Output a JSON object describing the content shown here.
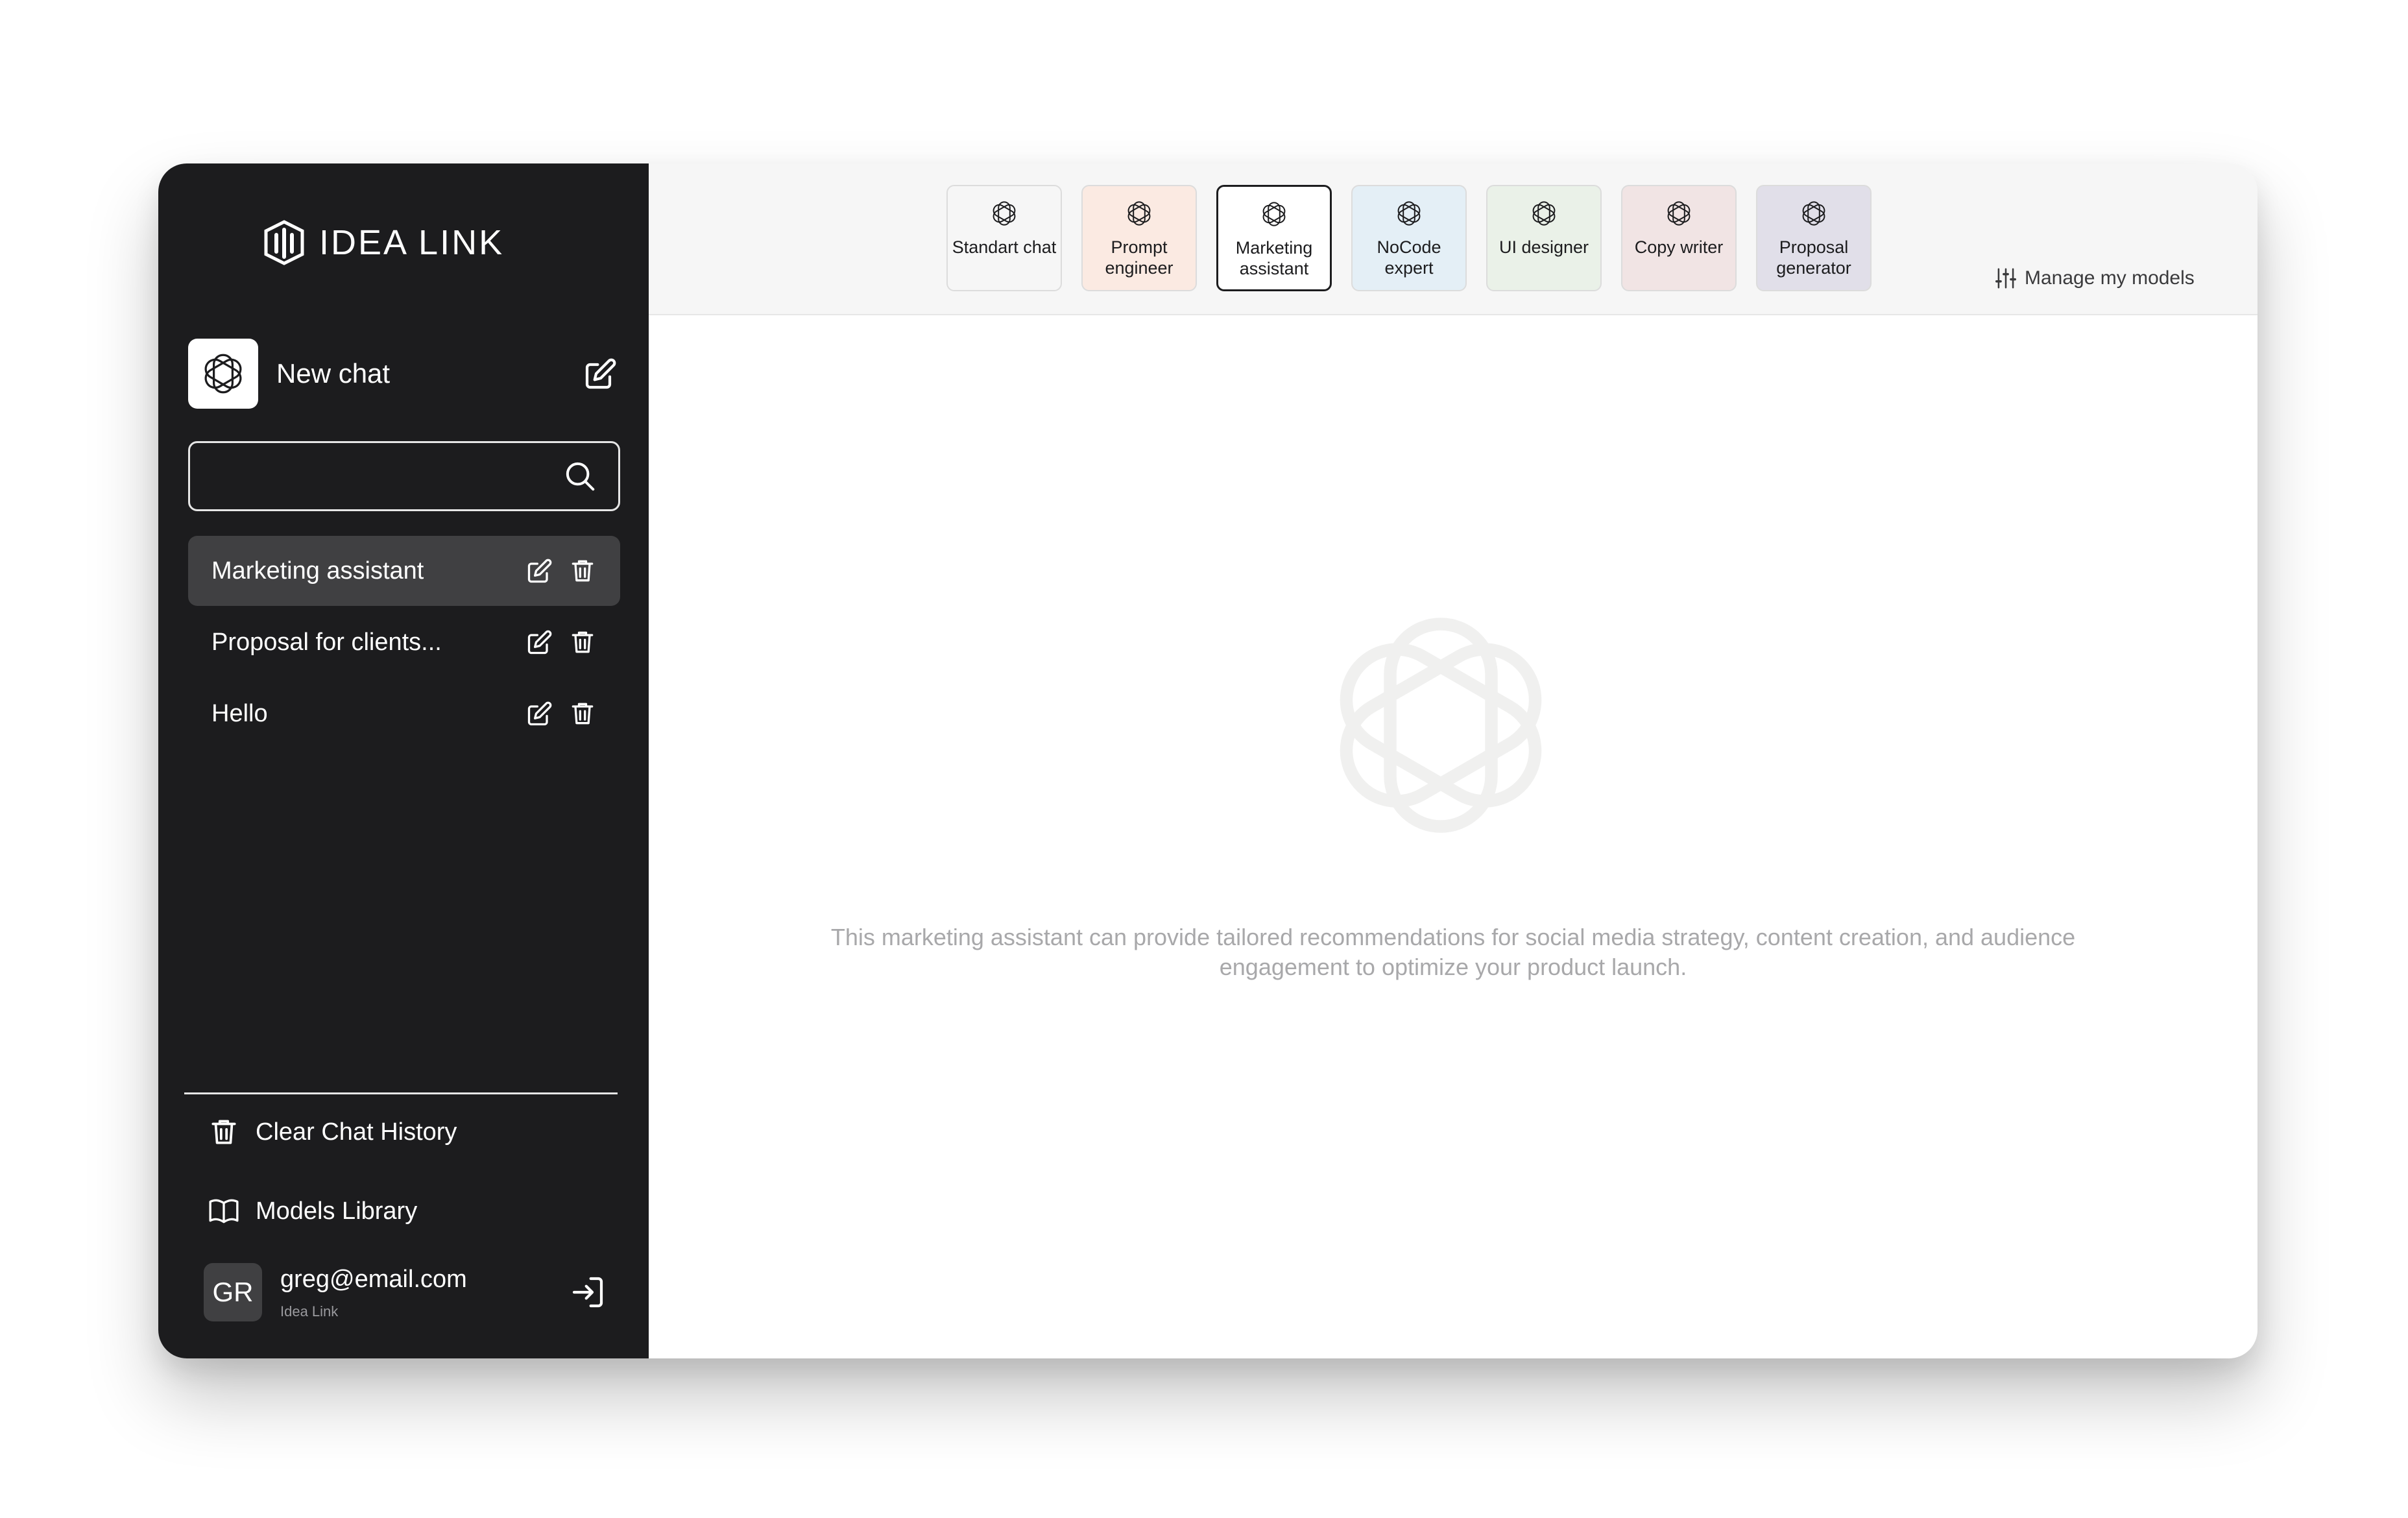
{
  "brand": {
    "name": "IDEA LINK"
  },
  "sidebar": {
    "new_chat_label": "New chat",
    "search_placeholder": "",
    "chats": [
      {
        "label": "Marketing assistant",
        "active": true
      },
      {
        "label": "Proposal for clients...",
        "active": false
      },
      {
        "label": "Hello",
        "active": false
      }
    ],
    "clear_history_label": "Clear Chat History",
    "models_library_label": "Models Library",
    "user": {
      "initials": "GR",
      "email": "greg@email.com",
      "org": "Idea Link"
    }
  },
  "models": [
    {
      "label": "Standart chat",
      "bg": "#f6f6f6",
      "selected": false
    },
    {
      "label": "Prompt engineer",
      "bg": "#fbeae2",
      "selected": false
    },
    {
      "label": "Marketing assistant",
      "bg": "#ffffff",
      "selected": true
    },
    {
      "label": "NoCode expert",
      "bg": "#e4eff6",
      "selected": false
    },
    {
      "label": "UI designer",
      "bg": "#eaf1e8",
      "selected": false
    },
    {
      "label": "Copy writer",
      "bg": "#f1e4e4",
      "selected": false
    },
    {
      "label": "Proposal generator",
      "bg": "#e1dfe9",
      "selected": false
    }
  ],
  "manage_models_label": "Manage my models",
  "description": "This marketing assistant can provide tailored recommendations for social media strategy, content creation, and audience engagement to optimize your product launch.",
  "colors": {
    "sidebar_bg": "#1c1c1e",
    "active_item": "#404042",
    "topbar_bg": "#f6f6f6"
  }
}
